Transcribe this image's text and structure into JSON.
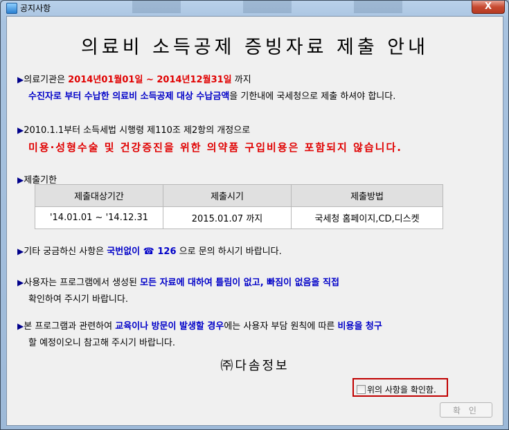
{
  "window": {
    "title": "공지사항",
    "close_symbol": "X"
  },
  "heading": "의료비 소득공제 증빙자료 제출 안내",
  "arrow": "▶",
  "notice1": {
    "prefix": "의료기관은 ",
    "start_date": "2014년01월01일",
    "tilde": " ~ ",
    "end_date": "2014년12월31일",
    "suffix": " 까지",
    "line2_blue": "수진자로 부터 수납한 의료비 소득공제 대상 수납금액",
    "line2_rest": "을 기한내에 국세청으로 제출 하셔야 합니다."
  },
  "notice2": {
    "line1": "2010.1.1부터 소득세법 시행령 제110조 제2항의 개정으로",
    "line2": "미용·성형수술 및 건강증진을 위한 의약품 구입비용은 포함되지 않습니다."
  },
  "deadline": {
    "label": "제출기한",
    "headers": [
      "제출대상기간",
      "제출시기",
      "제출방법"
    ],
    "row": [
      "'14.01.01 ~ '14.12.31",
      "2015.01.07 까지",
      "국세청 홈페이지,CD,디스켓"
    ]
  },
  "notice3": {
    "prefix": "기타 궁금하신 사항은 ",
    "phone_label": "국번없이 ☎ 126",
    "suffix": " 으로 문의 하시기 바랍니다."
  },
  "notice4": {
    "prefix": "사용자는 프로그램에서 생성된 ",
    "emphasis": "모든 자료에 대하여 틀림이 없고, 빠짐이 없음을 직접",
    "line2": "확인하여 주시기 바랍니다."
  },
  "notice5": {
    "prefix": "본 프로그램과 관련하여 ",
    "emphasis1": "교육이나 방문이 발생할 경우",
    "middle": "에는 사용자 부담 원칙에 따른 ",
    "emphasis2": "비용을 청구",
    "line2": "할 예정이오니 참고해 주시기 바랍니다."
  },
  "company": "㈜다솜정보",
  "confirm": {
    "label": "위의 사항을 확인함.",
    "checked": false
  },
  "ok_button": "확 인"
}
